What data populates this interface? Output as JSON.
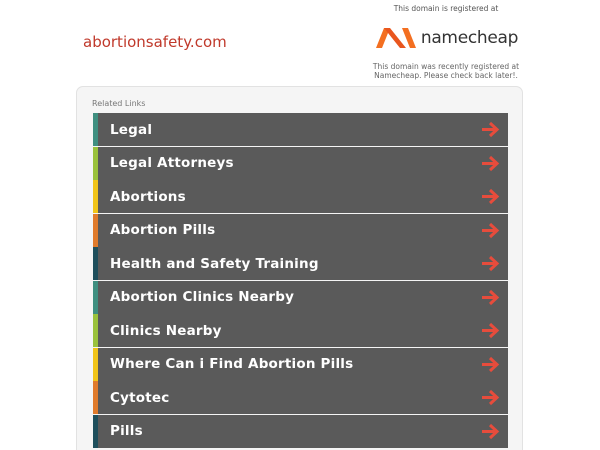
{
  "header": {
    "domain": "abortionsafety.com"
  },
  "registrar": {
    "line1": "This domain is registered at",
    "brand": "namecheap",
    "note_line1": "This domain was recently registered at",
    "note_line2": "Namecheap. Please check back later!."
  },
  "panel": {
    "title": "Related Links"
  },
  "links": [
    {
      "label": "Legal",
      "accent": "#3f8f80"
    },
    {
      "label": "Legal Attorneys",
      "accent": "#9ac23c"
    },
    {
      "label": "Abortions",
      "accent": "#f0c419"
    },
    {
      "label": "Abortion Pills",
      "accent": "#e07b2c"
    },
    {
      "label": "Health and Safety Training",
      "accent": "#1f4f5c"
    },
    {
      "label": "Abortion Clinics Nearby",
      "accent": "#3f8f80"
    },
    {
      "label": "Clinics Nearby",
      "accent": "#9ac23c"
    },
    {
      "label": "Where Can i Find Abortion Pills",
      "accent": "#f0c419"
    },
    {
      "label": "Cytotec",
      "accent": "#e07b2c"
    },
    {
      "label": "Pills",
      "accent": "#1f4f5c"
    }
  ],
  "colors": {
    "arrow": "#e74c3c",
    "brand_orange": "#f36f21",
    "link_bg": "#5a5a5a"
  },
  "icons": {
    "link_arrow": "arrow-right-icon",
    "brand_logo": "namecheap-logo-icon"
  }
}
